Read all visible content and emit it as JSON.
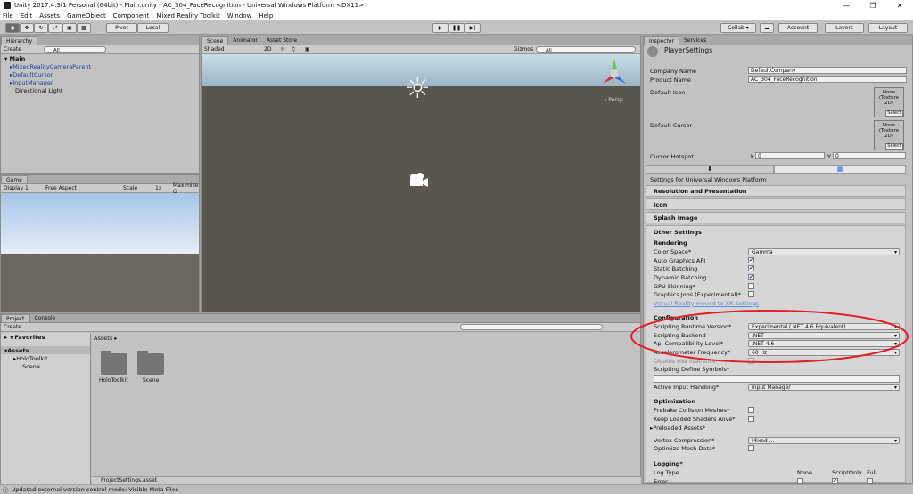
{
  "window": {
    "title": "Unity 2017.4.3f1 Personal (64bit) - Main.unity - AC_304_FaceRecognition - Universal Windows Platform <DX11>",
    "min": "—",
    "max": "❐",
    "close": "✕"
  },
  "menu": [
    "File",
    "Edit",
    "Assets",
    "GameObject",
    "Component",
    "Mixed Reality Toolkit",
    "Window",
    "Help"
  ],
  "toolbar": {
    "pivot": "Pivot",
    "local": "Local",
    "collab": "Collab ▾",
    "account": "Account",
    "layers": "Layers",
    "layout": "Layout"
  },
  "hierarchy": {
    "tab": "Hierarchy",
    "create": "Create",
    "search": "All",
    "scene": "Main",
    "items": [
      "MixedRealityCameraParent",
      "DefaultCursor",
      "InputManager",
      "Directional Light"
    ]
  },
  "scene": {
    "tabs": [
      "Scene",
      "Animator",
      "Asset Store"
    ],
    "shading": "Shaded",
    "mode2d": "2D",
    "gizmos": "Gizmos",
    "search": "All",
    "persp": "‹ Persp"
  },
  "game": {
    "tab": "Game",
    "display": "Display 1",
    "aspect": "Free Aspect",
    "scale_label": "Scale",
    "scale_value": "1x",
    "maximize": "Maximize O"
  },
  "project": {
    "tabs": [
      "Project",
      "Console"
    ],
    "create": "Create",
    "favorites": "Favorites",
    "assets": "Assets",
    "tree": [
      "HoloToolkit",
      "Scene"
    ],
    "breadcrumb": "Assets ▸",
    "folders": [
      "HoloToolkit",
      "Scene"
    ],
    "footer": "ProjectSettings.asset"
  },
  "inspector": {
    "tabs": [
      "Inspector",
      "Services"
    ],
    "title": "PlayerSettings",
    "company_label": "Company Name",
    "company": "DefaultCompany",
    "product_label": "Product Name",
    "product": "AC_304_FaceRecognition",
    "default_icon": "Default Icon",
    "default_cursor": "Default Cursor",
    "tex_none": "None (Texture 2D)",
    "select": "Select",
    "hotspot_label": "Cursor Hotspot",
    "x": "X",
    "xval": "0",
    "y": "Y",
    "yval": "0",
    "platform_text": "Settings for Universal Windows Platform",
    "sections": [
      "Resolution and Presentation",
      "Icon",
      "Splash Image"
    ],
    "other": "Other Settings",
    "rendering": "Rendering",
    "color_space_label": "Color Space*",
    "color_space": "Gamma",
    "r_checks": [
      {
        "label": "Auto Graphics API",
        "checked": true
      },
      {
        "label": "Static Batching",
        "checked": true
      },
      {
        "label": "Dynamic Batching",
        "checked": true
      },
      {
        "label": "GPU Skinning*",
        "checked": false
      },
      {
        "label": "Graphics Jobs (Experimental)*",
        "checked": false
      }
    ],
    "vr_link": "Virtual Reality moved to XR Settings",
    "configuration": "Configuration",
    "config": [
      {
        "label": "Scripting Runtime Version*",
        "value": "Experimental (.NET 4.6 Equivalent)"
      },
      {
        "label": "Scripting Backend",
        "value": ".NET"
      },
      {
        "label": "Api Compatibility Level*",
        "value": ".NET 4.6"
      },
      {
        "label": "Accelerometer Frequency*",
        "value": "60 Hz"
      }
    ],
    "disable_hw": "Disable HW Statistics*",
    "define_symbols": "Scripting Define Symbols*",
    "input_label": "Active Input Handling*",
    "input": "Input Manager",
    "optimization": "Optimization",
    "prebake": "Prebake Collision Meshes*",
    "keep_shaders": "Keep Loaded Shaders Alive*",
    "preloaded": "Preloaded Assets*",
    "vertex_label": "Vertex Compression*",
    "vertex": "Mixed ...",
    "optimize_mesh": "Optimize Mesh Data*",
    "logging": "Logging*",
    "log_type": "Log Type",
    "log_cols": [
      "None",
      "ScriptOnly",
      "Full"
    ],
    "error": "Error"
  },
  "status": "Updated external version control mode: Visible Meta Files",
  "colors": {
    "highlight": "#e2202b",
    "selection": "#3d78c6"
  }
}
